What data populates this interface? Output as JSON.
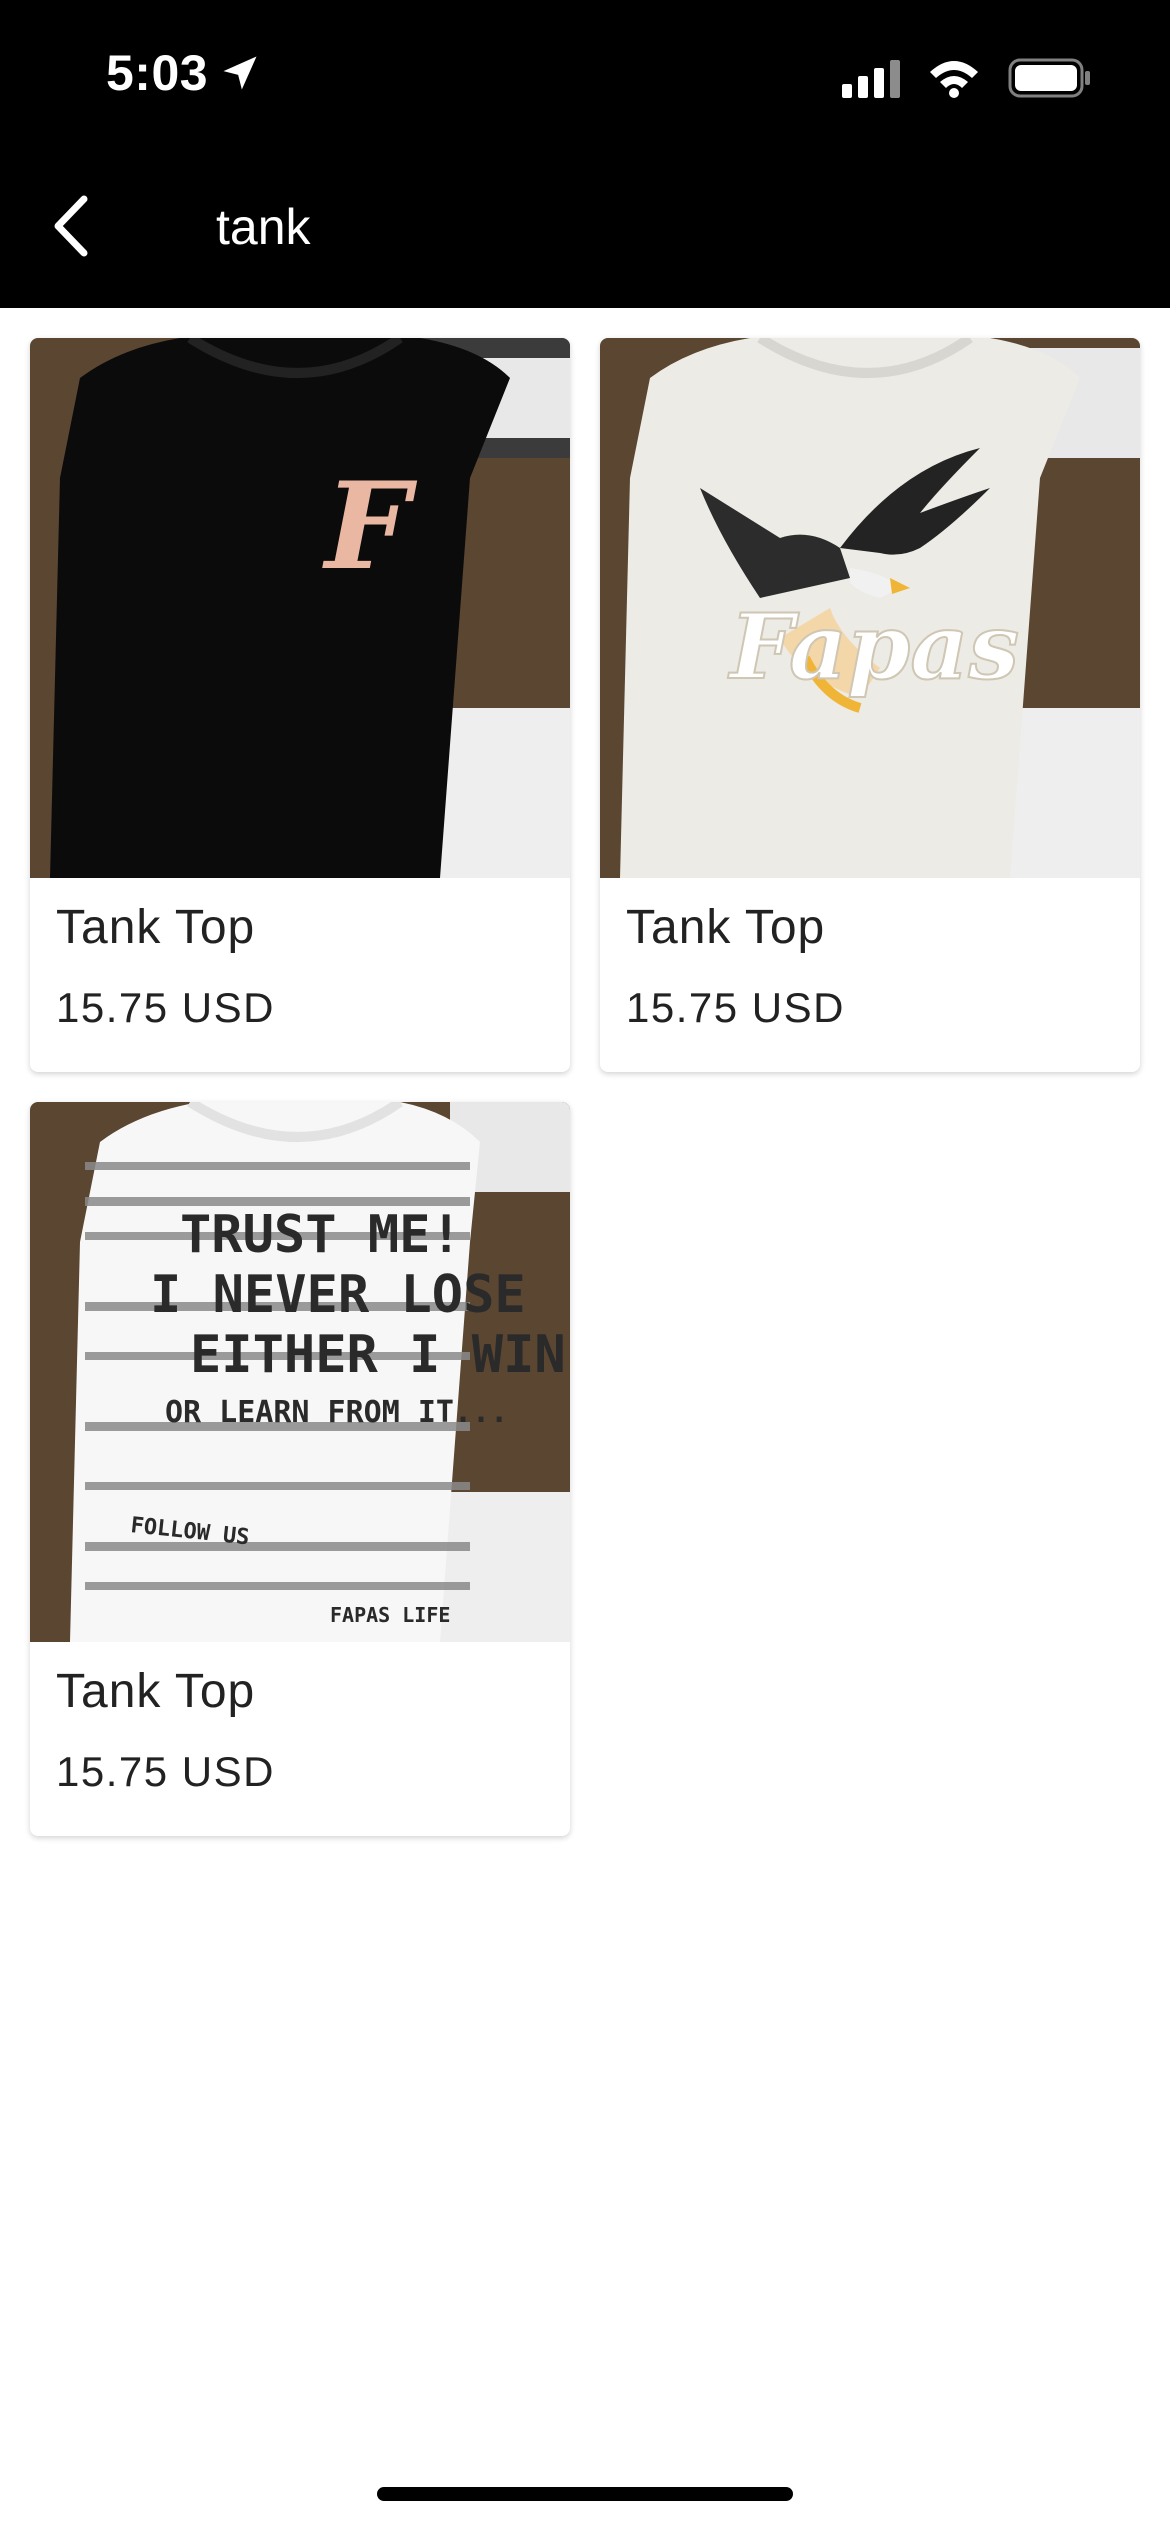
{
  "status_bar": {
    "time": "5:03",
    "icons": [
      "location-arrow-icon",
      "cellular-signal-icon",
      "wifi-icon",
      "battery-icon"
    ]
  },
  "nav": {
    "back_icon": "chevron-left-icon",
    "title": "tank"
  },
  "products": [
    {
      "name": "Tank Top",
      "price": "15.75 USD",
      "image": {
        "shirt_color": "#0b0b0b",
        "print": "gothic-letter",
        "print_text": "F"
      }
    },
    {
      "name": "Tank Top",
      "price": "15.75 USD",
      "image": {
        "shirt_color": "#ecebe6",
        "print": "eagle-logo",
        "print_text": "Fapas"
      }
    },
    {
      "name": "Tank Top",
      "price": "15.75 USD",
      "image": {
        "shirt_color": "#f7f7f7",
        "print": "striped-text",
        "print_lines": [
          "TRUST ME!",
          "I NEVER LOSE",
          "EITHER I WIN",
          "OR LEARN FROM IT..."
        ],
        "small_text_left": "FOLLOW US",
        "small_text_right": "FAPAS LIFE"
      }
    }
  ],
  "colors": {
    "header_bg": "#000000",
    "page_bg": "#ffffff",
    "text": "#222222",
    "leather_bg": "#5a4631"
  }
}
